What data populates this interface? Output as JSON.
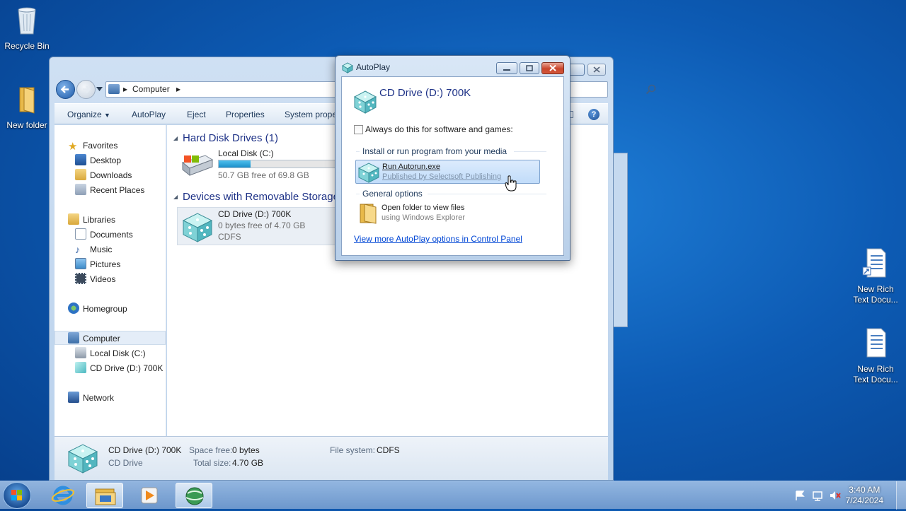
{
  "desktop": {
    "icons": [
      {
        "label": "Recycle Bin"
      },
      {
        "label": "New folder"
      },
      {
        "label": "New Rich Text Docu..."
      },
      {
        "label": "New Rich Text Docu..."
      }
    ]
  },
  "explorer": {
    "address": {
      "root": "Computer"
    },
    "toolbar": {
      "organize": "Organize",
      "autoplay": "AutoPlay",
      "eject": "Eject",
      "properties": "Properties",
      "system": "System prope"
    },
    "nav": {
      "favorites": "Favorites",
      "desktop": "Desktop",
      "downloads": "Downloads",
      "recent": "Recent Places",
      "libraries": "Libraries",
      "documents": "Documents",
      "music": "Music",
      "pictures": "Pictures",
      "videos": "Videos",
      "homegroup": "Homegroup",
      "computer": "Computer",
      "local_disk": "Local Disk (C:)",
      "cd_drive": "CD Drive (D:) 700K",
      "network": "Network"
    },
    "content": {
      "hdd_group": "Hard Disk Drives (1)",
      "local_disk": {
        "name": "Local Disk (C:)",
        "free": "50.7 GB free of 69.8 GB",
        "used_fraction": 0.27
      },
      "removable_group": "Devices with Removable Storage",
      "cd_drive": {
        "name": "CD Drive (D:) 700K",
        "free": "0 bytes free of 4.70 GB",
        "fs": "CDFS"
      }
    },
    "status": {
      "name": "CD Drive (D:) 700K",
      "type": "CD Drive",
      "space_free_label": "Space free:",
      "space_free": "0 bytes",
      "total_size_label": "Total size:",
      "total_size": "4.70 GB",
      "fs_label": "File system:",
      "fs": "CDFS"
    }
  },
  "autoplay": {
    "title": "AutoPlay",
    "drive": "CD Drive (D:) 700K",
    "always_label": "Always do this for software and games:",
    "section_install": "Install or run program from your media",
    "run_title": "Run Autorun.exe",
    "run_sub": "Published by Selectsoft Publishing",
    "section_general": "General options",
    "open_title": "Open folder to view files",
    "open_sub": "using Windows Explorer",
    "more_link": "View more AutoPlay options in Control Panel"
  },
  "taskbar": {
    "time": "3:40 AM",
    "date": "7/24/2024"
  },
  "colors": {
    "accent": "#1e3287",
    "link": "#0046d5",
    "capacity_bar": "#26a0da"
  }
}
